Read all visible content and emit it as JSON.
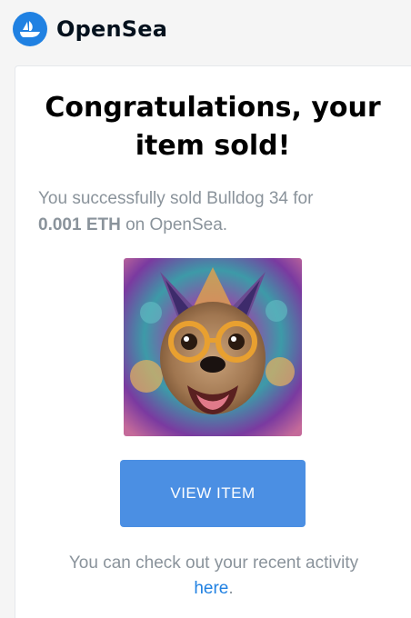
{
  "header": {
    "brand": "OpenSea",
    "logo_icon": "opensea-boat-icon"
  },
  "email": {
    "headline_line1": "Congratulations, your",
    "headline_line2": "item sold!",
    "message_prefix": "You successfully sold Bulldog 34 for",
    "price": "0.001 ETH",
    "message_suffix": " on OpenSea.",
    "image_alt": "Bulldog 34",
    "button_label": "VIEW ITEM",
    "footer_text": "You can check out your recent activity",
    "footer_link": "here",
    "footer_end": "."
  },
  "colors": {
    "brand": "#2081e2",
    "button": "#4b8fe3",
    "muted_text": "#8a939b"
  }
}
